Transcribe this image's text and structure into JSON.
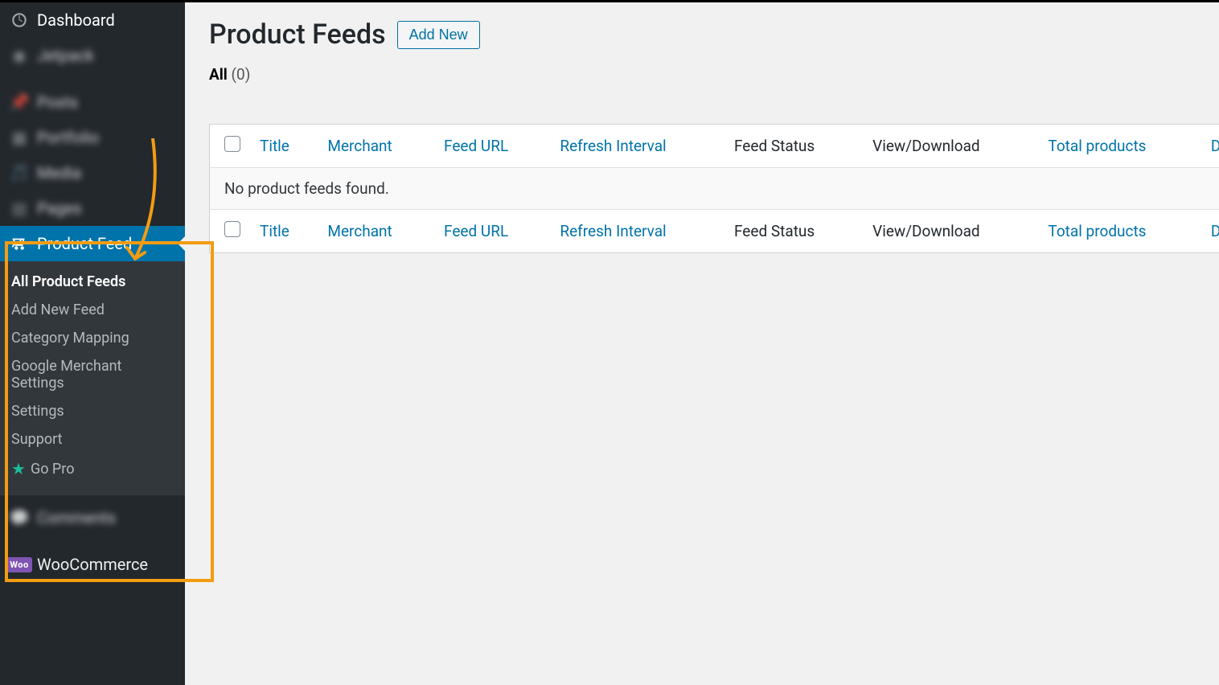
{
  "sidebar": {
    "dashboard": "Dashboard",
    "blurred": [
      "Jetpack",
      "Posts",
      "Portfolio",
      "Media",
      "Pages"
    ],
    "product_feed": "Product Feed",
    "submenu": {
      "all": "All Product Feeds",
      "add": "Add New Feed",
      "category": "Category Mapping",
      "merchant": "Google Merchant Settings",
      "settings": "Settings",
      "support": "Support",
      "gopro": "Go Pro"
    },
    "comments": "Comments",
    "woocommerce": "WooCommerce"
  },
  "page": {
    "title": "Product Feeds",
    "add_new": "Add New",
    "filter_label": "All",
    "filter_count": "(0)"
  },
  "table": {
    "cols": {
      "title": "Title",
      "merchant": "Merchant",
      "feed_url": "Feed URL",
      "refresh": "Refresh Interval",
      "status": "Feed Status",
      "view": "View/Download",
      "total": "Total products",
      "date": "Da"
    },
    "empty": "No product feeds found."
  }
}
